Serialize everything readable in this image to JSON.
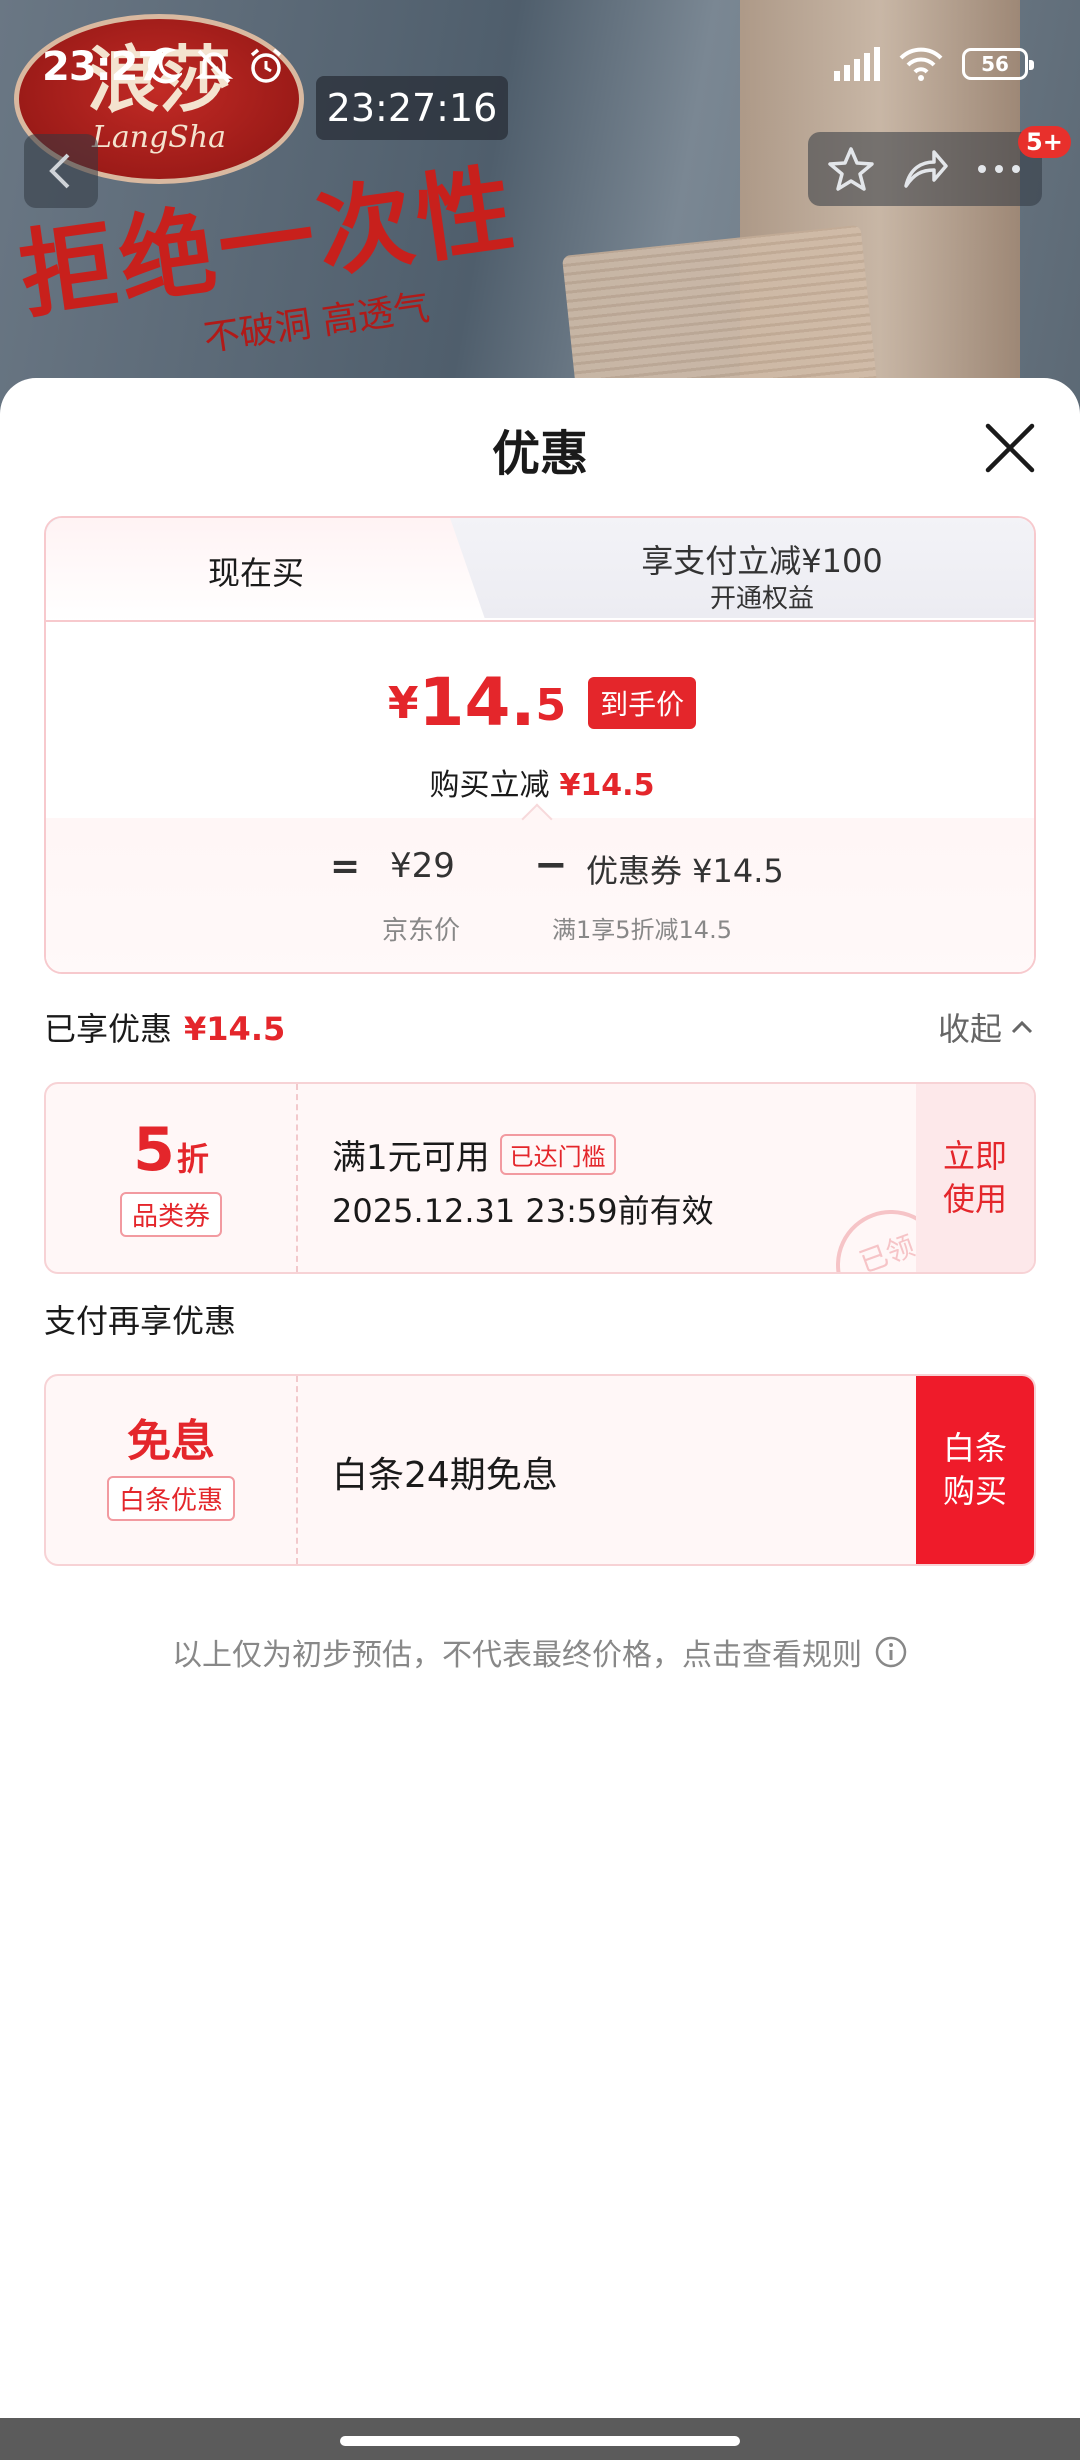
{
  "status_bar": {
    "time": "23:27",
    "battery": "56",
    "network": "HD"
  },
  "overlay": {
    "clock_pill": "23:27:16",
    "more_badge": "5+"
  },
  "background": {
    "logo_glyph": "浪莎",
    "logo_sub": "LangSha",
    "slogan_big": "拒绝一次性",
    "slogan_small": "不破洞 高透气"
  },
  "sheet": {
    "title": "优惠",
    "tabs": {
      "now": "现在买",
      "pay_title": "享支付立减¥100",
      "pay_sub": "开通权益"
    },
    "hand_price": {
      "yen": "¥",
      "int": "14.",
      "dec": "5",
      "tag": "到手价"
    },
    "reduce": {
      "label": "购买立减",
      "amount": "¥14.5"
    },
    "breakdown": {
      "eq": "=",
      "jd_price": "¥29",
      "minus": "−",
      "coupon": "优惠券 ¥14.5",
      "jd_label": "京东价",
      "coupon_label": "满1享5折减14.5"
    },
    "enjoyed": {
      "label": "已享优惠",
      "amount": "¥14.5",
      "collapse": "收起"
    },
    "coupon1": {
      "big": "5",
      "big_unit": "折",
      "tag": "品类券",
      "line1": "满1元可用",
      "line1_tag": "已达门槛",
      "line2": "2025.12.31 23:59前有效",
      "stamp": "已领",
      "action": "立即使用"
    },
    "pay_more_title": "支付再享优惠",
    "coupon2": {
      "big": "免息",
      "tag": "白条优惠",
      "line": "白条24期免息",
      "action": "白条购买"
    },
    "disclaimer": "以上仅为初步预估，不代表最终价格，点击查看规则"
  },
  "colors": {
    "accent_red": "#e4262b",
    "button_red": "#ef1b2a",
    "card_border": "#f7c9cd"
  }
}
